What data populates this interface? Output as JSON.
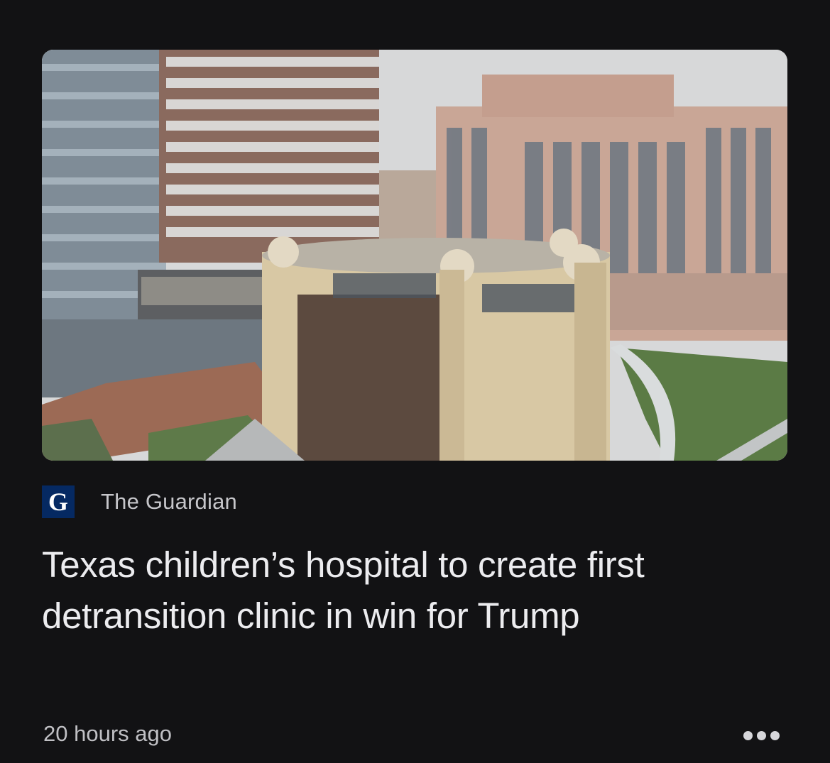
{
  "article": {
    "image_alt": "Hospital buildings in Houston medical center",
    "source": {
      "logo_letter": "G",
      "name": "The Guardian",
      "logo_color": "#052962"
    },
    "headline": "Texas children’s hospital to create first detransition clinic in win for Trump",
    "timestamp": "20 hours ago",
    "more_icon": "more-horizontal-icon"
  },
  "colors": {
    "background": "#121214",
    "headline": "#ececef",
    "meta_text": "#c0c0c4"
  }
}
